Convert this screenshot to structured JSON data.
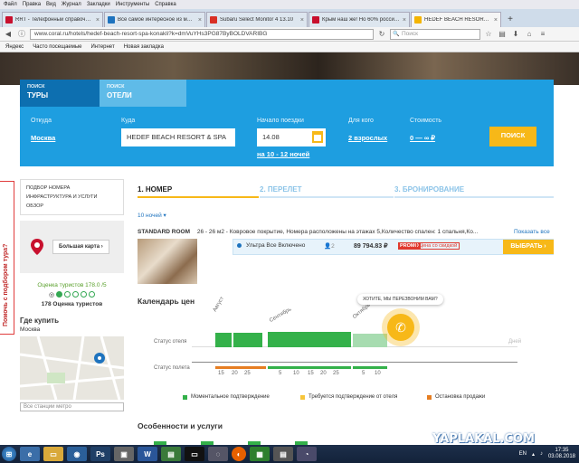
{
  "menubar": [
    "Файл",
    "Правка",
    "Вид",
    "Журнал",
    "Закладки",
    "Инструменты",
    "Справка"
  ],
  "tabs": [
    {
      "title": "RRT - Телефонный справочник",
      "color": "#c8102e"
    },
    {
      "title": "Все самое интересное из мира",
      "color": "#1e73be"
    },
    {
      "title": "Subaru Select Monitor 4 13.10",
      "color": "#d93025"
    },
    {
      "title": "Крым наш же! Но 60% россиян",
      "color": "#c8102e"
    },
    {
      "title": "HEDEF BEACH RESORT & SPA",
      "color": "#f4b400",
      "active": true
    }
  ],
  "address": "www.coral.ru/hotels/hedef-beach-resort-spa-konakli?k=dmVuYHs3PG87ByBOLDVARIBG",
  "search_placeholder": "Поиск",
  "bookmarks": [
    "Яндекс",
    "Часто посещаемые",
    "Интернет",
    "Новая закладка"
  ],
  "search": {
    "tab_tours_small": "ПОИСК",
    "tab_tours": "ТУРЫ",
    "tab_hotels_small": "ПОИСК",
    "tab_hotels": "ОТЕЛИ",
    "from_label": "Откуда",
    "from_value": "Москва",
    "to_label": "Куда",
    "to_value": "HEDEF BEACH RESORT & SPA",
    "date_label": "Начало поездки",
    "date_value": "14.08",
    "nights": "на 10 - 12 ночей",
    "who_label": "Для кого",
    "who_value": "2 взрослых",
    "price_label": "Стоимость",
    "price_value": "0 — ∞ ₽",
    "button": "ПОИСК"
  },
  "sidebar": {
    "menu": [
      "ПОДБОР НОМЕРА",
      "ИНФРАСТРУКТУРА И УСЛУГИ",
      "ОБЗОР"
    ],
    "map_button": "Большая карта",
    "rating_label": "Оценка туристов 178.0 /5",
    "rating_count": "178 Оценка туристов",
    "where_buy": "Где купить",
    "city": "Москва",
    "metro_placeholder": "Все станции метро"
  },
  "vertical_tab": "Помочь с подбором тура?",
  "steps": [
    {
      "label": "1. НОМЕР",
      "color": "#222",
      "line": "#f7b818"
    },
    {
      "label": "2. ПЕРЕЛЕТ",
      "color": "#8cc4e8",
      "line": "#cfe5f5"
    },
    {
      "label": "3. БРОНИРОВАНИЕ",
      "color": "#8cc4e8",
      "line": "#cfe5f5"
    }
  ],
  "nights_select": "10 ночей",
  "room": {
    "name": "STANDARD ROOM",
    "desc": "26 - 26 м2 - Ковровое покрытие, Номера расположены на этажах 5,Количество спален: 1 спальня,Ко...",
    "show_all": "Показать все",
    "meal": "Ультра Все Включено",
    "guests": "2",
    "price": "89 794.83 ₽",
    "promo": "PROMO",
    "promo_text": "Цена со скидкой",
    "choose": "ВЫБРАТЬ"
  },
  "calendar": {
    "title": "Календарь цен",
    "hotel_status": "Статус отеля",
    "flight_status": "Статус полета",
    "days_label": "Дней",
    "months": [
      "Август",
      "Сентябрь",
      "Октябрь"
    ],
    "ticks": [
      "15",
      "20",
      "25",
      "5",
      "10",
      "15",
      "20",
      "25",
      "5",
      "10"
    ],
    "legend": [
      {
        "label": "Моментальное подтверждение",
        "color": "#34b14a"
      },
      {
        "label": "Требуется подтверждение от отеля",
        "color": "#f7c53a"
      },
      {
        "label": "Остановка продажи",
        "color": "#e67e22"
      }
    ]
  },
  "callback_bubble": "ХОТИТЕ, МЫ ПЕРЕЗВОНИМ ВАМ?",
  "features_title": "Особенности и услуги",
  "watermark": "YAPLAKAL.COM",
  "tray": {
    "lang": "EN",
    "time": "17:35",
    "date": "03.08.2018"
  }
}
